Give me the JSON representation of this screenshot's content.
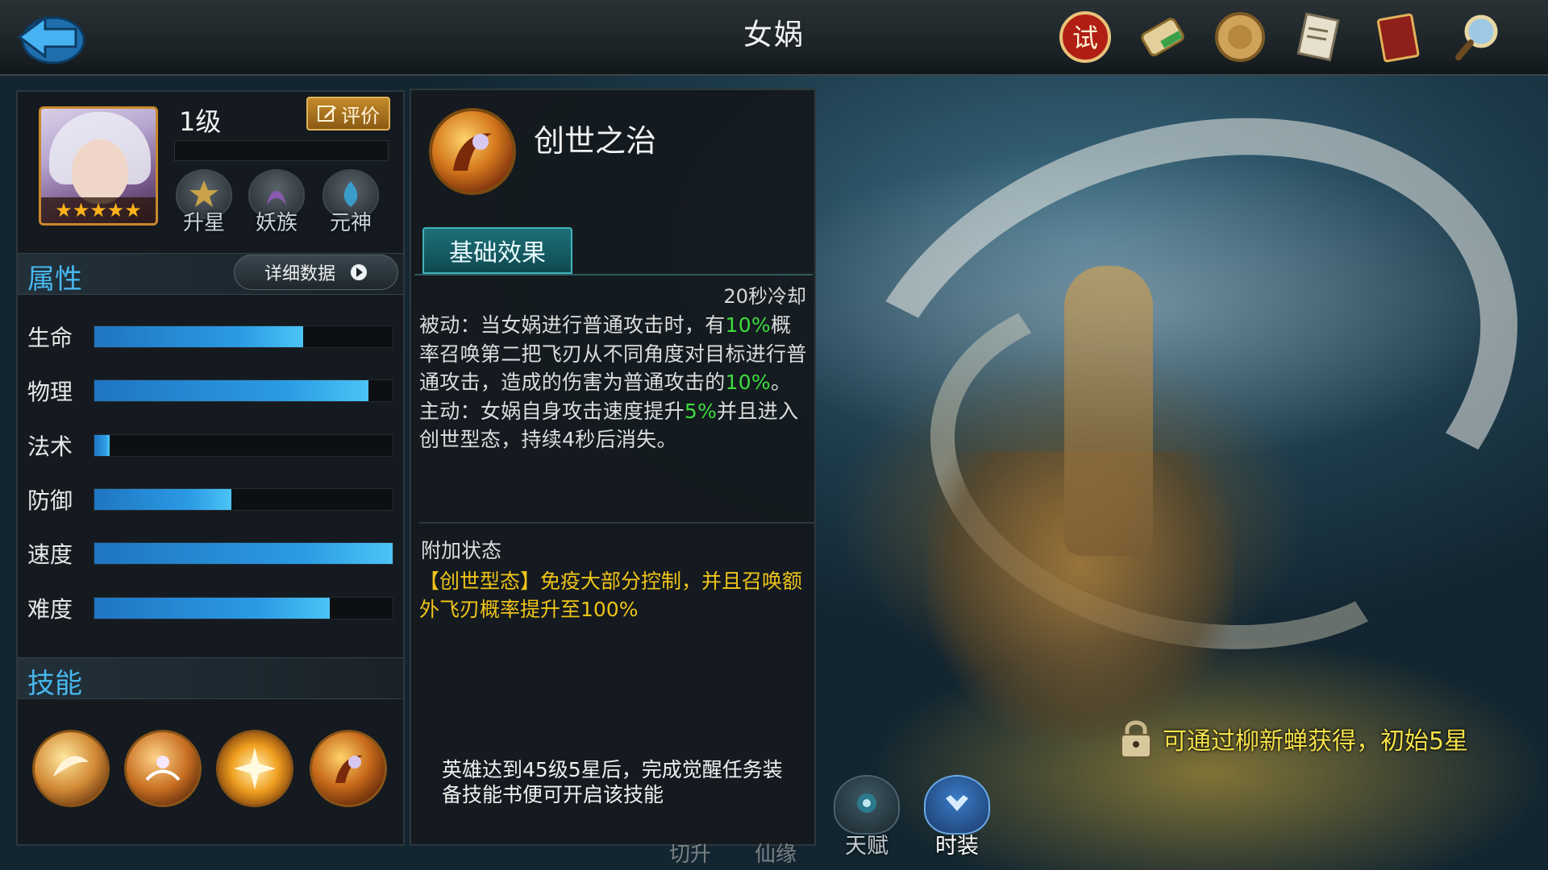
{
  "header": {
    "title": "女娲",
    "top_icons": [
      "challenge-icon",
      "scroll-icon",
      "coin-icon",
      "notice-scroll-icon",
      "handbook-icon",
      "magnifier-icon"
    ],
    "challenge_glyph": "试"
  },
  "hero": {
    "level": "1级",
    "stars": "★★★★★",
    "rate_label": "评价",
    "badges": [
      {
        "label": "升星"
      },
      {
        "label": "妖族"
      },
      {
        "label": "元神"
      }
    ]
  },
  "attributes": {
    "header": "属性",
    "detail_button": "详细数据",
    "stats": [
      {
        "name": "生命",
        "value": 0.7
      },
      {
        "name": "物理",
        "value": 0.92
      },
      {
        "name": "法术",
        "value": 0.05
      },
      {
        "name": "防御",
        "value": 0.46
      },
      {
        "name": "速度",
        "value": 1.0
      },
      {
        "name": "难度",
        "value": 0.79
      }
    ]
  },
  "skills": {
    "header": "技能",
    "icons": [
      "skill-1-icon",
      "skill-2-icon",
      "skill-3-icon",
      "skill-4-icon"
    ]
  },
  "skill_detail": {
    "name": "创世之治",
    "tab": "基础效果",
    "cooldown": "20秒冷却",
    "desc_parts": [
      {
        "text": "被动：当女娲进行普通攻击时，有",
        "hl": false
      },
      {
        "text": "10%",
        "hl": true
      },
      {
        "text": "概率召唤第二把飞刃从不同角度对目标进行普通攻击，造成的伤害为普通攻击的",
        "hl": false
      },
      {
        "text": "10%",
        "hl": true
      },
      {
        "text": "。主动：女娲自身攻击速度提升",
        "hl": false
      },
      {
        "text": "5%",
        "hl": true
      },
      {
        "text": "并且进入创世型态，持续4秒后消失。",
        "hl": false
      }
    ],
    "extra_title": "附加状态",
    "extra_desc": "【创世型态】免疫大部分控制，并且召唤额外飞刃概率提升至100%",
    "unlock_note": "英雄达到45级5星后，完成觉醒任务装备技能书便可开启该技能"
  },
  "bottom_tabs": [
    {
      "label": "天赋",
      "color": "#c6cdd2"
    },
    {
      "label": "时装",
      "color": "#ffffff"
    }
  ],
  "faint_tabs": [
    "切升",
    "仙缘"
  ],
  "source": {
    "text": "可通过柳新蝉获得，初始5星"
  },
  "colors": {
    "accent_blue": "#48b8ee",
    "highlight_green": "#3ddc3d",
    "highlight_yellow": "#f0c419",
    "bar_blue": "#2b9be4",
    "tab_teal": "#1d7078"
  }
}
